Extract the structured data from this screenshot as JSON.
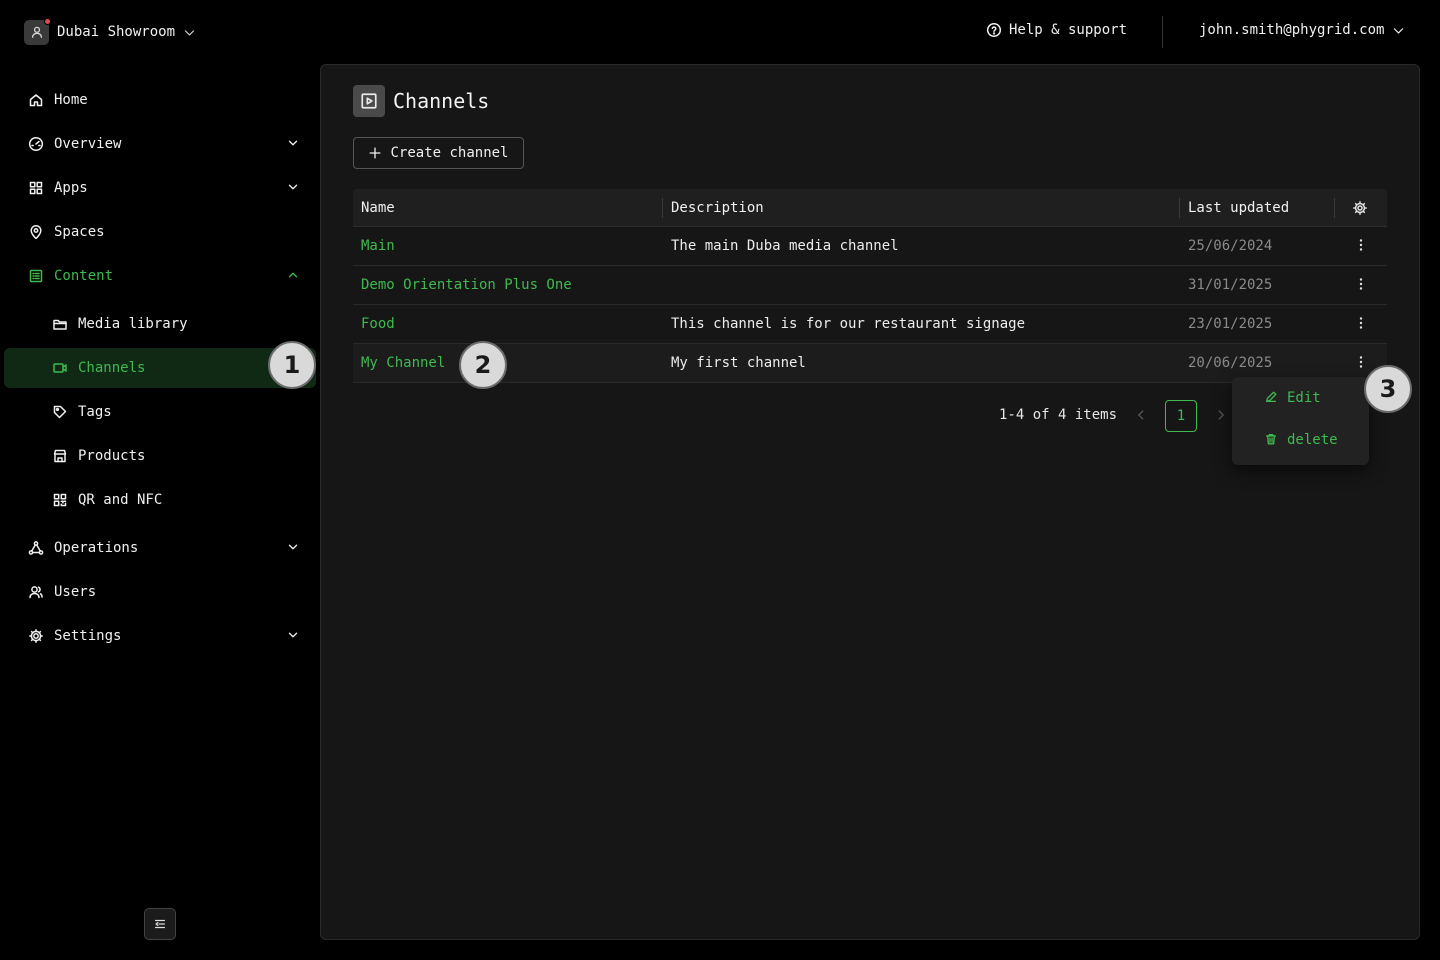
{
  "header": {
    "org_name": "Dubai Showroom",
    "help_label": "Help & support",
    "user_email": "john.smith@phygrid.com"
  },
  "sidebar": {
    "items": [
      {
        "label": "Home",
        "icon": "home-icon"
      },
      {
        "label": "Overview",
        "icon": "gauge-icon",
        "expandable": true
      },
      {
        "label": "Apps",
        "icon": "grid-icon",
        "expandable": true
      },
      {
        "label": "Spaces",
        "icon": "map-pin-icon"
      },
      {
        "label": "Content",
        "icon": "content-icon",
        "expandable": true,
        "expanded": true
      },
      {
        "label": "Media library",
        "icon": "folder-icon"
      },
      {
        "label": "Channels",
        "icon": "video-icon",
        "active": true
      },
      {
        "label": "Tags",
        "icon": "tag-icon"
      },
      {
        "label": "Products",
        "icon": "store-icon"
      },
      {
        "label": "QR and NFC",
        "icon": "qr-icon"
      },
      {
        "label": "Operations",
        "icon": "network-icon",
        "expandable": true
      },
      {
        "label": "Users",
        "icon": "users-icon"
      },
      {
        "label": "Settings",
        "icon": "gear-icon",
        "expandable": true
      }
    ]
  },
  "page": {
    "title": "Channels",
    "create_label": "Create channel"
  },
  "table": {
    "columns": [
      "Name",
      "Description",
      "Last updated"
    ],
    "rows": [
      {
        "name": "Main",
        "description": "The main Duba media channel",
        "updated": "25/06/2024"
      },
      {
        "name": "Demo Orientation Plus One",
        "description": "",
        "updated": "31/01/2025"
      },
      {
        "name": "Food",
        "description": "This channel is for our restaurant signage",
        "updated": "23/01/2025"
      },
      {
        "name": "My Channel",
        "description": "My first channel",
        "updated": "20/06/2025"
      }
    ]
  },
  "pagination": {
    "summary": "1-4 of 4 items",
    "current_page": "1"
  },
  "row_menu": {
    "edit_label": "Edit",
    "delete_label": "delete"
  },
  "markers": [
    "1",
    "2",
    "3"
  ],
  "colors": {
    "accent": "#3fb950",
    "active_bg": "#0f2915",
    "panel_bg": "#161616",
    "page_bg": "#000000"
  }
}
